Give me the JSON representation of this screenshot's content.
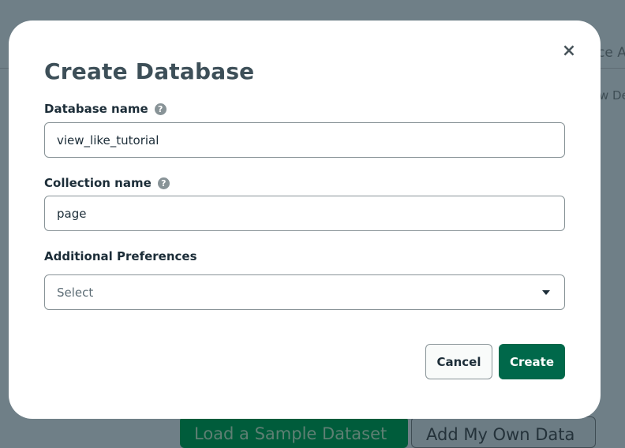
{
  "background": {
    "tab_fragment": "ce A",
    "side_fragment": "w De",
    "load_sample_label": "Load a Sample Dataset",
    "add_own_data_label": "Add My Own Data"
  },
  "modal": {
    "title": "Create Database",
    "close_glyph": "×",
    "database_name": {
      "label": "Database name",
      "value": "view_like_tutorial"
    },
    "collection_name": {
      "label": "Collection name",
      "value": "page"
    },
    "additional_preferences": {
      "label": "Additional Preferences",
      "selected": "Select"
    },
    "help_glyph": "?",
    "cancel_label": "Cancel",
    "create_label": "Create"
  },
  "colors": {
    "primary": "#00684a",
    "overlay": "#6f7f87",
    "title": "#3d4f58"
  },
  "icons": [
    "close-icon",
    "help-icon",
    "chevron-down-icon"
  ]
}
